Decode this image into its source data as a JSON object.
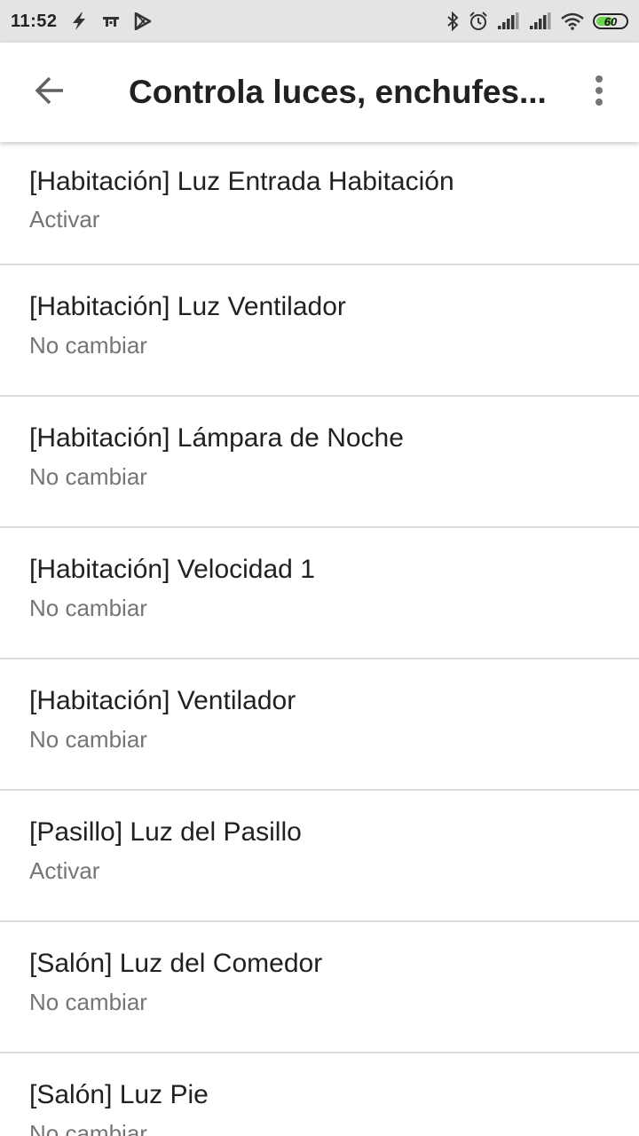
{
  "status_bar": {
    "time": "11:52",
    "battery_level": "60",
    "battery_fraction": 0.6,
    "icons_left": [
      "flash-icon",
      "tt-app-icon",
      "play-store-icon"
    ],
    "icons_right": [
      "bluetooth-icon",
      "alarm-icon",
      "signal-icon",
      "signal-icon",
      "wifi-icon",
      "battery-icon"
    ]
  },
  "app_bar": {
    "title": "Controla luces, enchufes...",
    "back_icon": "arrow-back-icon",
    "menu_icon": "more-vert-icon"
  },
  "items": [
    {
      "title": "[Habitación] Luz Entrada Habitación",
      "subtitle": "Activar"
    },
    {
      "title": "[Habitación] Luz Ventilador",
      "subtitle": "No cambiar"
    },
    {
      "title": "[Habitación] Lámpara de Noche",
      "subtitle": "No cambiar"
    },
    {
      "title": "[Habitación] Velocidad 1",
      "subtitle": "No cambiar"
    },
    {
      "title": "[Habitación] Ventilador",
      "subtitle": "No cambiar"
    },
    {
      "title": "[Pasillo] Luz del Pasillo",
      "subtitle": "Activar"
    },
    {
      "title": "[Salón] Luz del Comedor",
      "subtitle": "No cambiar"
    },
    {
      "title": "[Salón] Luz Pie",
      "subtitle": "No cambiar"
    }
  ],
  "colors": {
    "status_bar_bg": "#e4e4e4",
    "title_text": "#212121",
    "subtitle_text": "#757575",
    "divider": "#dddddd",
    "battery_fill": "#6bd34d"
  }
}
